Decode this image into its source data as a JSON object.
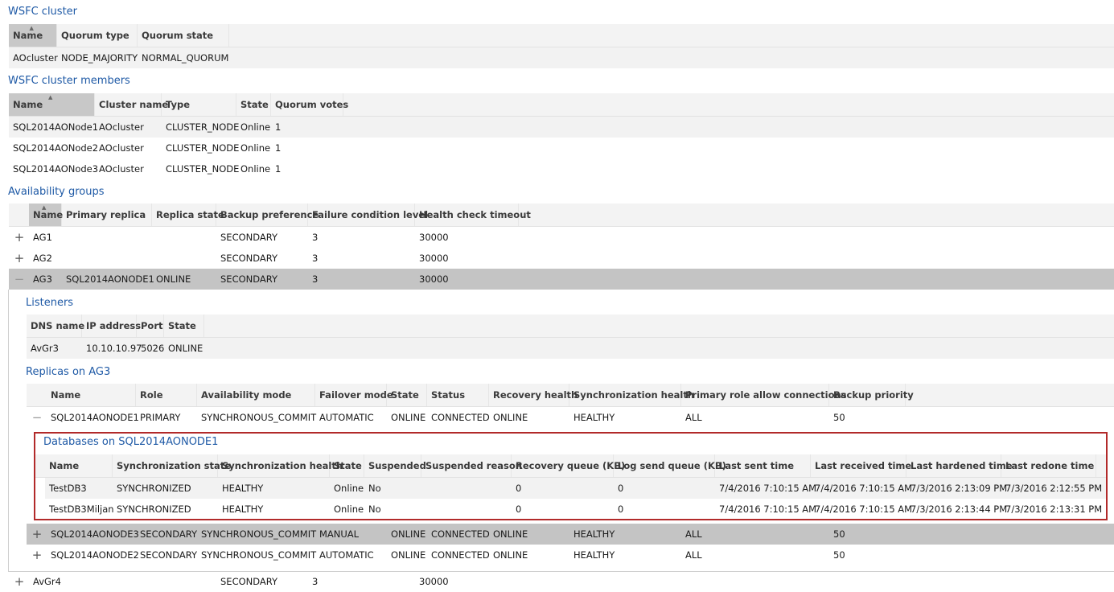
{
  "wsfc_cluster": {
    "title": "WSFC cluster",
    "columns": [
      "Name",
      "Quorum type",
      "Quorum state"
    ],
    "rows": [
      [
        "AOcluster",
        "NODE_MAJORITY",
        "NORMAL_QUORUM"
      ]
    ]
  },
  "wsfc_members": {
    "title": "WSFC cluster members",
    "columns": [
      "Name",
      "Cluster name",
      "Type",
      "State",
      "Quorum votes"
    ],
    "rows": [
      [
        "SQL2014AONode1",
        "AOcluster",
        "CLUSTER_NODE",
        "Online",
        "1"
      ],
      [
        "SQL2014AONode2",
        "AOcluster",
        "CLUSTER_NODE",
        "Online",
        "1"
      ],
      [
        "SQL2014AONode3",
        "AOcluster",
        "CLUSTER_NODE",
        "Online",
        "1"
      ]
    ]
  },
  "availability_groups": {
    "title": "Availability groups",
    "columns": [
      "Name",
      "Primary replica",
      "Replica state",
      "Backup preference",
      "Failure condition level",
      "Health check timeout"
    ],
    "rows": [
      {
        "expander": "+",
        "cells": [
          "AG1",
          "",
          "",
          "SECONDARY",
          "3",
          "30000"
        ]
      },
      {
        "expander": "+",
        "cells": [
          "AG2",
          "",
          "",
          "SECONDARY",
          "3",
          "30000"
        ]
      },
      {
        "expander": "−",
        "cells": [
          "AG3",
          "SQL2014AONODE1",
          "ONLINE",
          "SECONDARY",
          "3",
          "30000"
        ]
      },
      {
        "expander": "+",
        "cells": [
          "AvGr4",
          "",
          "",
          "SECONDARY",
          "3",
          "30000"
        ]
      }
    ]
  },
  "listeners": {
    "title": "Listeners",
    "columns": [
      "DNS name",
      "IP address",
      "Port",
      "State"
    ],
    "rows": [
      [
        "AvGr3",
        "10.10.10.97",
        "5026",
        "ONLINE"
      ]
    ]
  },
  "replicas": {
    "title": "Replicas on AG3",
    "columns": [
      "Name",
      "Role",
      "Availability mode",
      "Failover mode",
      "State",
      "Status",
      "Recovery health",
      "Synchronization health",
      "Primary role allow connections",
      "Backup priority"
    ],
    "rows": [
      {
        "expander": "−",
        "cells": [
          "SQL2014AONODE1",
          "PRIMARY",
          "SYNCHRONOUS_COMMIT",
          "AUTOMATIC",
          "ONLINE",
          "CONNECTED",
          "ONLINE",
          "HEALTHY",
          "ALL",
          "50"
        ]
      },
      {
        "expander": "+",
        "cells": [
          "SQL2014AONODE3",
          "SECONDARY",
          "SYNCHRONOUS_COMMIT",
          "MANUAL",
          "ONLINE",
          "CONNECTED",
          "ONLINE",
          "HEALTHY",
          "ALL",
          "50"
        ]
      },
      {
        "expander": "+",
        "cells": [
          "SQL2014AONODE2",
          "SECONDARY",
          "SYNCHRONOUS_COMMIT",
          "AUTOMATIC",
          "ONLINE",
          "CONNECTED",
          "ONLINE",
          "HEALTHY",
          "ALL",
          "50"
        ]
      }
    ]
  },
  "databases": {
    "title": "Databases on SQL2014AONODE1",
    "columns": [
      "Name",
      "Synchronization state",
      "Synchronization health",
      "State",
      "Suspended",
      "Suspended reason",
      "Recovery queue (KB)",
      "Log send queue (KB)",
      "Last sent time",
      "Last received time",
      "Last hardened time",
      "Last redone time"
    ],
    "rows": [
      [
        "TestDB3",
        "SYNCHRONIZED",
        "HEALTHY",
        "Online",
        "No",
        "",
        "0",
        "0",
        "7/4/2016 7:10:15 AM",
        "7/4/2016 7:10:15 AM",
        "7/3/2016 2:13:09 PM",
        "7/3/2016 2:12:55 PM"
      ],
      [
        "TestDB3Miljan",
        "SYNCHRONIZED",
        "HEALTHY",
        "Online",
        "No",
        "",
        "0",
        "0",
        "7/4/2016 7:10:15 AM",
        "7/4/2016 7:10:15 AM",
        "7/3/2016 2:13:44 PM",
        "7/3/2016 2:13:31 PM"
      ]
    ]
  },
  "colors": {
    "section_title": "#1f5aa6",
    "highlight_border": "#b22a2a",
    "selected_row": "#c4c4c4"
  },
  "icons": {
    "expand": "plus-icon",
    "collapse": "minus-icon",
    "sort": "sort-ascending-icon"
  }
}
